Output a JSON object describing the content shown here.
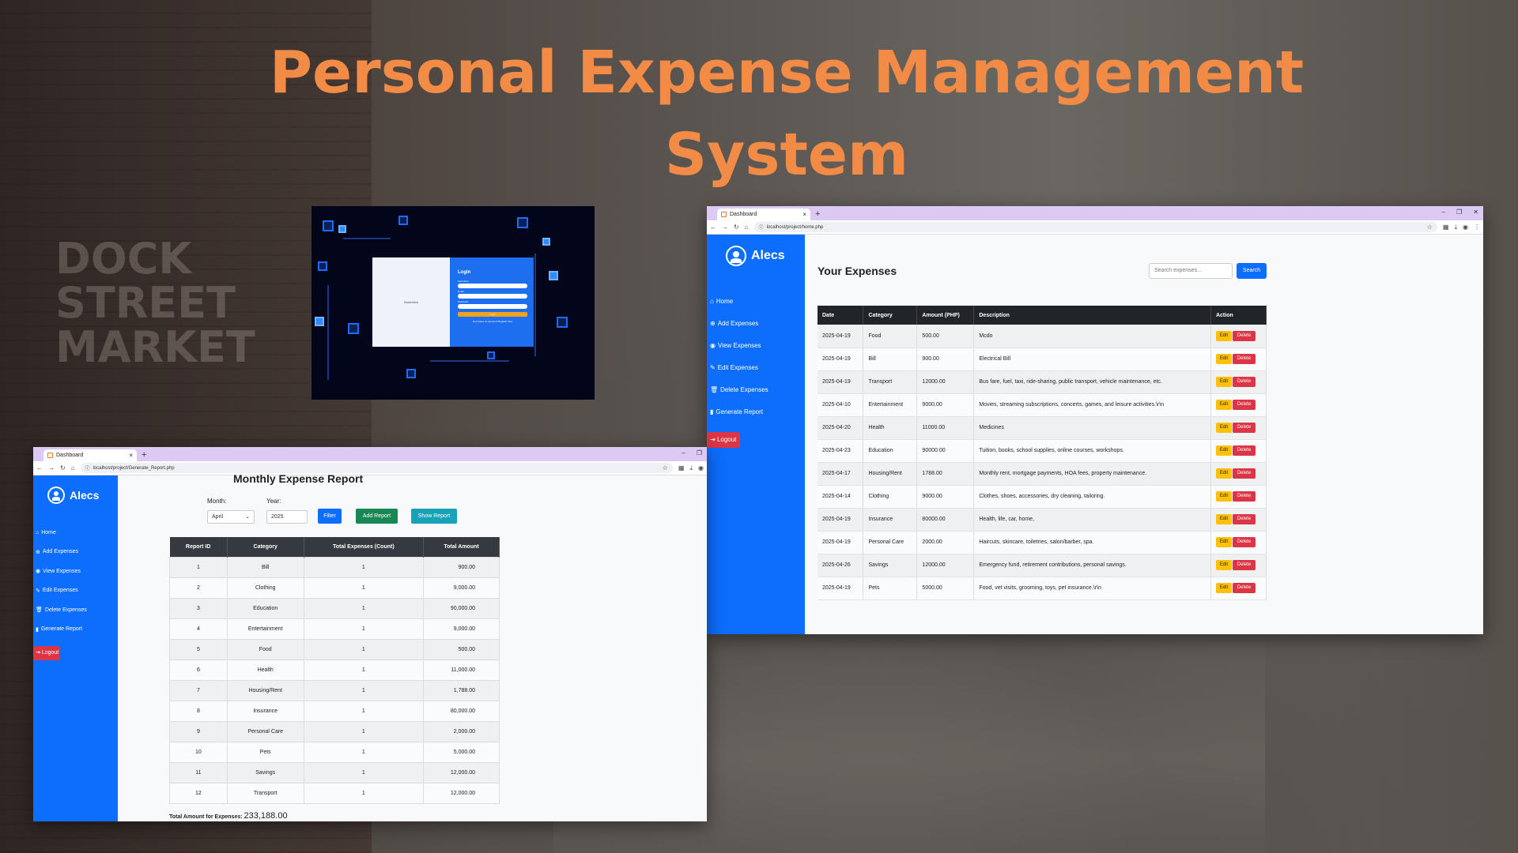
{
  "hero": {
    "line1": "Personal Expense Management",
    "line2": "System"
  },
  "login": {
    "illustration": "Illustration",
    "title": "Login",
    "username_label": "Username",
    "email_label": "Email",
    "password_label": "Password",
    "button": "Login",
    "register_text": "Don't have an account? Register here"
  },
  "dashboard": {
    "tab_title": "Dashboard",
    "url": "localhost/project/home.php",
    "brand": "Alecs",
    "nav": [
      {
        "icon": "home-icon",
        "label": "Home"
      },
      {
        "icon": "plus-circle-icon",
        "label": "Add Expenses"
      },
      {
        "icon": "eye-icon",
        "label": "View Expenses"
      },
      {
        "icon": "pencil-icon",
        "label": "Edit Expenses"
      },
      {
        "icon": "trash-icon",
        "label": "Delete Expenses"
      },
      {
        "icon": "bar-chart-icon",
        "label": "Generate Report"
      }
    ],
    "logout": "Logout",
    "title": "Your Expenses",
    "search_placeholder": "Search expenses...",
    "search_button": "Search",
    "columns": [
      "Date",
      "Category",
      "Amount (PHP)",
      "Description",
      "Action"
    ],
    "edit_label": "Edit",
    "delete_label": "Delete",
    "rows": [
      {
        "date": "2025-04-19",
        "category": "Food",
        "amount": "500.00",
        "description": "Mcdo"
      },
      {
        "date": "2025-04-19",
        "category": "Bill",
        "amount": "900.00",
        "description": "Electrical Bill"
      },
      {
        "date": "2025-04-19",
        "category": "Transport",
        "amount": "12000.00",
        "description": "Bus fare, fuel, taxi, ride-sharing, public transport, vehicle maintenance, etc."
      },
      {
        "date": "2025-04-10",
        "category": "Entertainment",
        "amount": "9000.00",
        "description": "Movies, streaming subscriptions, concerts, games, and leisure activities.\\r\\n"
      },
      {
        "date": "2025-04-20",
        "category": "Health",
        "amount": "11000.00",
        "description": "Medicines"
      },
      {
        "date": "2025-04-23",
        "category": "Education",
        "amount": "90000.00",
        "description": "Tuition, books, school supplies, online courses, workshops."
      },
      {
        "date": "2025-04-17",
        "category": "Housing/Rent",
        "amount": "1788.00",
        "description": "Monthly rent, mortgage payments, HOA fees, property maintenance."
      },
      {
        "date": "2025-04-14",
        "category": "Clothing",
        "amount": "9000.00",
        "description": "Clothes, shoes, accessories, dry cleaning, tailoring."
      },
      {
        "date": "2025-04-19",
        "category": "Insurance",
        "amount": "80000.00",
        "description": "Health, life, car, home,"
      },
      {
        "date": "2025-04-19",
        "category": "Personal Care",
        "amount": "2000.00",
        "description": "Haircuts, skincare, toiletries, salon/barber, spa."
      },
      {
        "date": "2025-04-26",
        "category": "Savings",
        "amount": "12000.00",
        "description": "Emergency fund, retirement contributions, personal savings."
      },
      {
        "date": "2025-04-19",
        "category": "Pets",
        "amount": "5000.00",
        "description": "Food, vet visits, grooming, toys, pet insurance.\\r\\n"
      }
    ]
  },
  "report": {
    "tab_title": "Dashboard",
    "url": "localhost/project/Generate_Report.php",
    "brand": "Alecs",
    "nav": [
      {
        "icon": "home-icon",
        "label": "Home"
      },
      {
        "icon": "plus-circle-icon",
        "label": "Add Expenses"
      },
      {
        "icon": "eye-icon",
        "label": "View Expenses"
      },
      {
        "icon": "pencil-icon",
        "label": "Edit Expenses"
      },
      {
        "icon": "trash-icon",
        "label": "Delete Expenses"
      },
      {
        "icon": "bar-chart-icon",
        "label": "Generate Report"
      }
    ],
    "logout": "Logout",
    "title": "Monthly Expense Report",
    "month_label": "Month:",
    "month_value": "April",
    "year_label": "Year:",
    "year_value": "2025",
    "filter_button": "Filter",
    "add_report_button": "Add Report",
    "show_report_button": "Show Report",
    "columns": [
      "Report ID",
      "Category",
      "Total Expenses (Count)",
      "Total Amount"
    ],
    "rows": [
      {
        "id": "1",
        "category": "Bill",
        "count": "1",
        "amount": "900.00"
      },
      {
        "id": "2",
        "category": "Clothing",
        "count": "1",
        "amount": "9,000.00"
      },
      {
        "id": "3",
        "category": "Education",
        "count": "1",
        "amount": "90,000.00"
      },
      {
        "id": "4",
        "category": "Entertainment",
        "count": "1",
        "amount": "9,000.00"
      },
      {
        "id": "5",
        "category": "Food",
        "count": "1",
        "amount": "500.00"
      },
      {
        "id": "6",
        "category": "Health",
        "count": "1",
        "amount": "11,000.00"
      },
      {
        "id": "7",
        "category": "Housing/Rent",
        "count": "1",
        "amount": "1,788.00"
      },
      {
        "id": "8",
        "category": "Insurance",
        "count": "1",
        "amount": "80,000.00"
      },
      {
        "id": "9",
        "category": "Personal Care",
        "count": "1",
        "amount": "2,000.00"
      },
      {
        "id": "10",
        "category": "Pets",
        "count": "1",
        "amount": "5,000.00"
      },
      {
        "id": "11",
        "category": "Savings",
        "count": "1",
        "amount": "12,000.00"
      },
      {
        "id": "12",
        "category": "Transport",
        "count": "1",
        "amount": "12,000.00"
      }
    ],
    "total_label": "Total Amount for Expenses:",
    "total_value": "233,188.00"
  },
  "colors": {
    "accent": "#f28b45",
    "sidebar": "#0d6efd",
    "logout": "#dc3545",
    "edit": "#ffc107",
    "filter": "#0d6efd",
    "add_report": "#198754",
    "show_report": "#17a2b8"
  }
}
